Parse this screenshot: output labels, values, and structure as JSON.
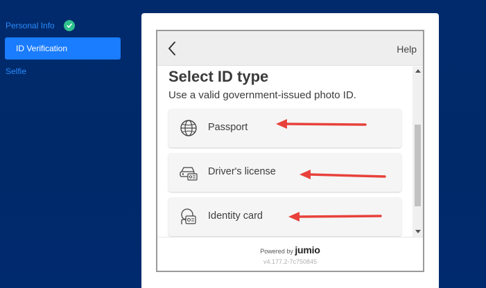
{
  "sidebar": {
    "steps": [
      {
        "label": "Personal Info",
        "status": "complete",
        "icon": "check-icon"
      },
      {
        "label": "ID Verification",
        "status": "active"
      },
      {
        "label": "Selfie",
        "status": "pending"
      }
    ]
  },
  "widget": {
    "help_label": "Help",
    "back_icon": "chevron-left-icon",
    "title": "Select ID type",
    "subtitle": "Use a valid government-issued photo ID.",
    "options": [
      {
        "label": "Passport",
        "icon": "globe-icon"
      },
      {
        "label": "Driver's license",
        "icon": "car-license-icon"
      },
      {
        "label": "Identity card",
        "icon": "identity-card-icon"
      }
    ],
    "footer": {
      "powered_by": "Powered by",
      "brand": "jumio",
      "version": "v4.177.2-7c750845"
    }
  },
  "colors": {
    "background": "#002a6b",
    "active_step": "#1a7cff",
    "step_text": "#2b8cff",
    "check": "#2fc28f",
    "annotation_arrow": "#e8413b"
  }
}
